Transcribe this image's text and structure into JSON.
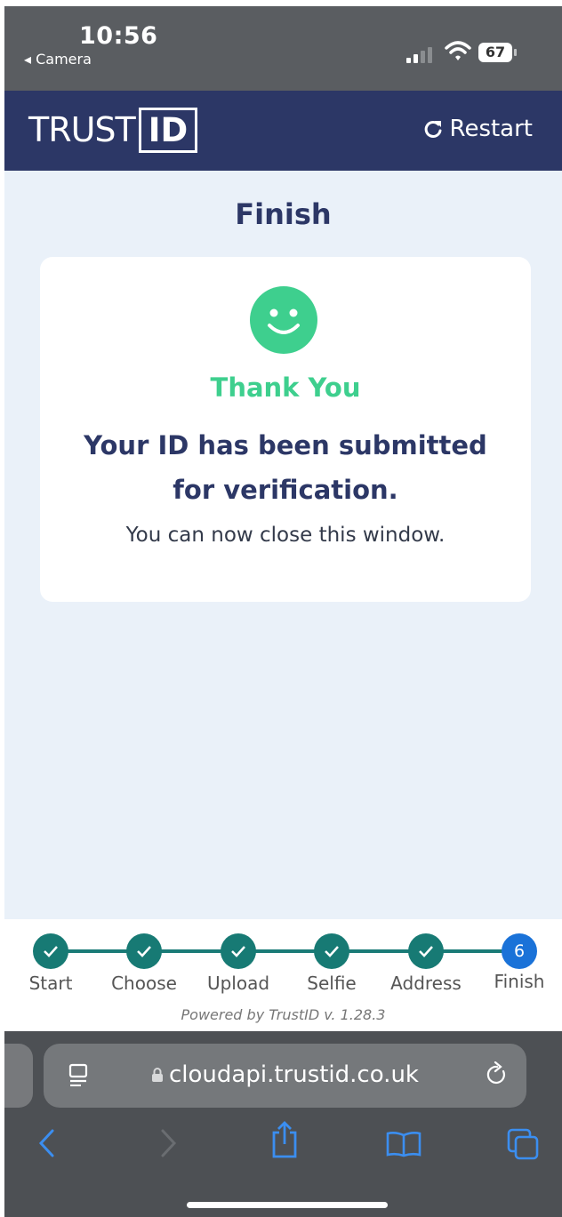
{
  "status_bar": {
    "time": "10:56",
    "back_label": "◂ Camera",
    "battery": "67"
  },
  "header": {
    "logo_trust": "TRUST",
    "logo_id": "ID",
    "restart_label": "Restart"
  },
  "main": {
    "title": "Finish",
    "thanks": "Thank You",
    "submitted": "Your ID has been submitted for verification.",
    "close_message": "You can now close this window."
  },
  "stepper": {
    "steps": [
      {
        "label": "Start",
        "state": "done"
      },
      {
        "label": "Choose",
        "state": "done"
      },
      {
        "label": "Upload",
        "state": "done"
      },
      {
        "label": "Selfie",
        "state": "done"
      },
      {
        "label": "Address",
        "state": "done"
      },
      {
        "label": "Finish",
        "state": "current",
        "number": "6"
      }
    ],
    "powered_by": "Powered by TrustID v. 1.28.3"
  },
  "browser": {
    "url": "cloudapi.trustid.co.uk"
  },
  "colors": {
    "header_bg": "#2c3766",
    "accent_green": "#3ecf8e",
    "step_done": "#177a74",
    "step_current": "#1a72d8",
    "content_bg": "#eaf1f9"
  }
}
